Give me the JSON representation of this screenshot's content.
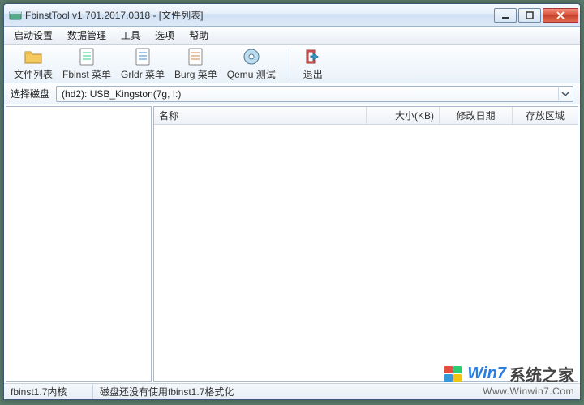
{
  "title": "FbinstTool v1.701.2017.0318 - [文件列表]",
  "menus": [
    "启动设置",
    "数据管理",
    "工具",
    "选项",
    "帮助"
  ],
  "toolbar": [
    {
      "icon": "folder",
      "label": "文件列表"
    },
    {
      "icon": "page",
      "label": "Fbinst 菜单"
    },
    {
      "icon": "page",
      "label": "Grldr 菜单"
    },
    {
      "icon": "page",
      "label": "Burg 菜单"
    },
    {
      "icon": "disc",
      "label": "Qemu 测试"
    }
  ],
  "exit_label": "退出",
  "disk": {
    "label": "选择磁盘",
    "value": "(hd2): USB_Kingston(7g, I:)"
  },
  "columns": {
    "name": "名称",
    "size": "大小(KB)",
    "date": "修改日期",
    "area": "存放区域"
  },
  "status": {
    "core": "fbinst1.7内核",
    "msg": "磁盘还没有使用fbinst1.7格式化"
  },
  "watermark": {
    "brand_prefix": "Win7",
    "brand_rest": "系统之家",
    "url": "Www.Winwin7.Com"
  }
}
